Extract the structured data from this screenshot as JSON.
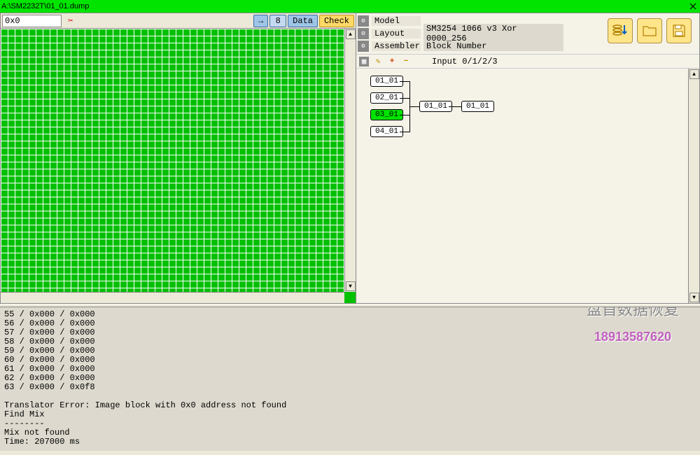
{
  "window": {
    "title": "A:\\SM2232T\\01_01.dump"
  },
  "toolbar": {
    "address_value": "0x0",
    "arrow_label": "→",
    "num_label": "8",
    "data_label": "Data",
    "check_label": "Check"
  },
  "right": {
    "rows": [
      {
        "label": "Model",
        "value": ""
      },
      {
        "label": "Layout",
        "value": "SM3254 1066 v3 Xor 0000_256"
      },
      {
        "label": "Assembler",
        "value": "Block Number"
      }
    ],
    "sub": {
      "input_label": "Input 0/1/2/3"
    },
    "nodes": {
      "n1": "01_01",
      "n2": "02_01",
      "n3": "03_01",
      "n4": "04_01",
      "n5": "01_01",
      "n6": "01_01"
    }
  },
  "log_lines": [
    "55 / 0x000 / 0x000",
    "56 / 0x000 / 0x000",
    "57 / 0x000 / 0x000",
    "58 / 0x000 / 0x000",
    "59 / 0x000 / 0x000",
    "60 / 0x000 / 0x000",
    "61 / 0x000 / 0x000",
    "62 / 0x000 / 0x000",
    "63 / 0x000 / 0x0f8",
    "",
    "Translator Error: Image block with 0x0 address not found",
    "Find Mix",
    "--------",
    "Mix not found",
    "Time: 207000 ms"
  ],
  "watermark": {
    "line1": "盘首数据恢复",
    "line2": "18913587620"
  }
}
